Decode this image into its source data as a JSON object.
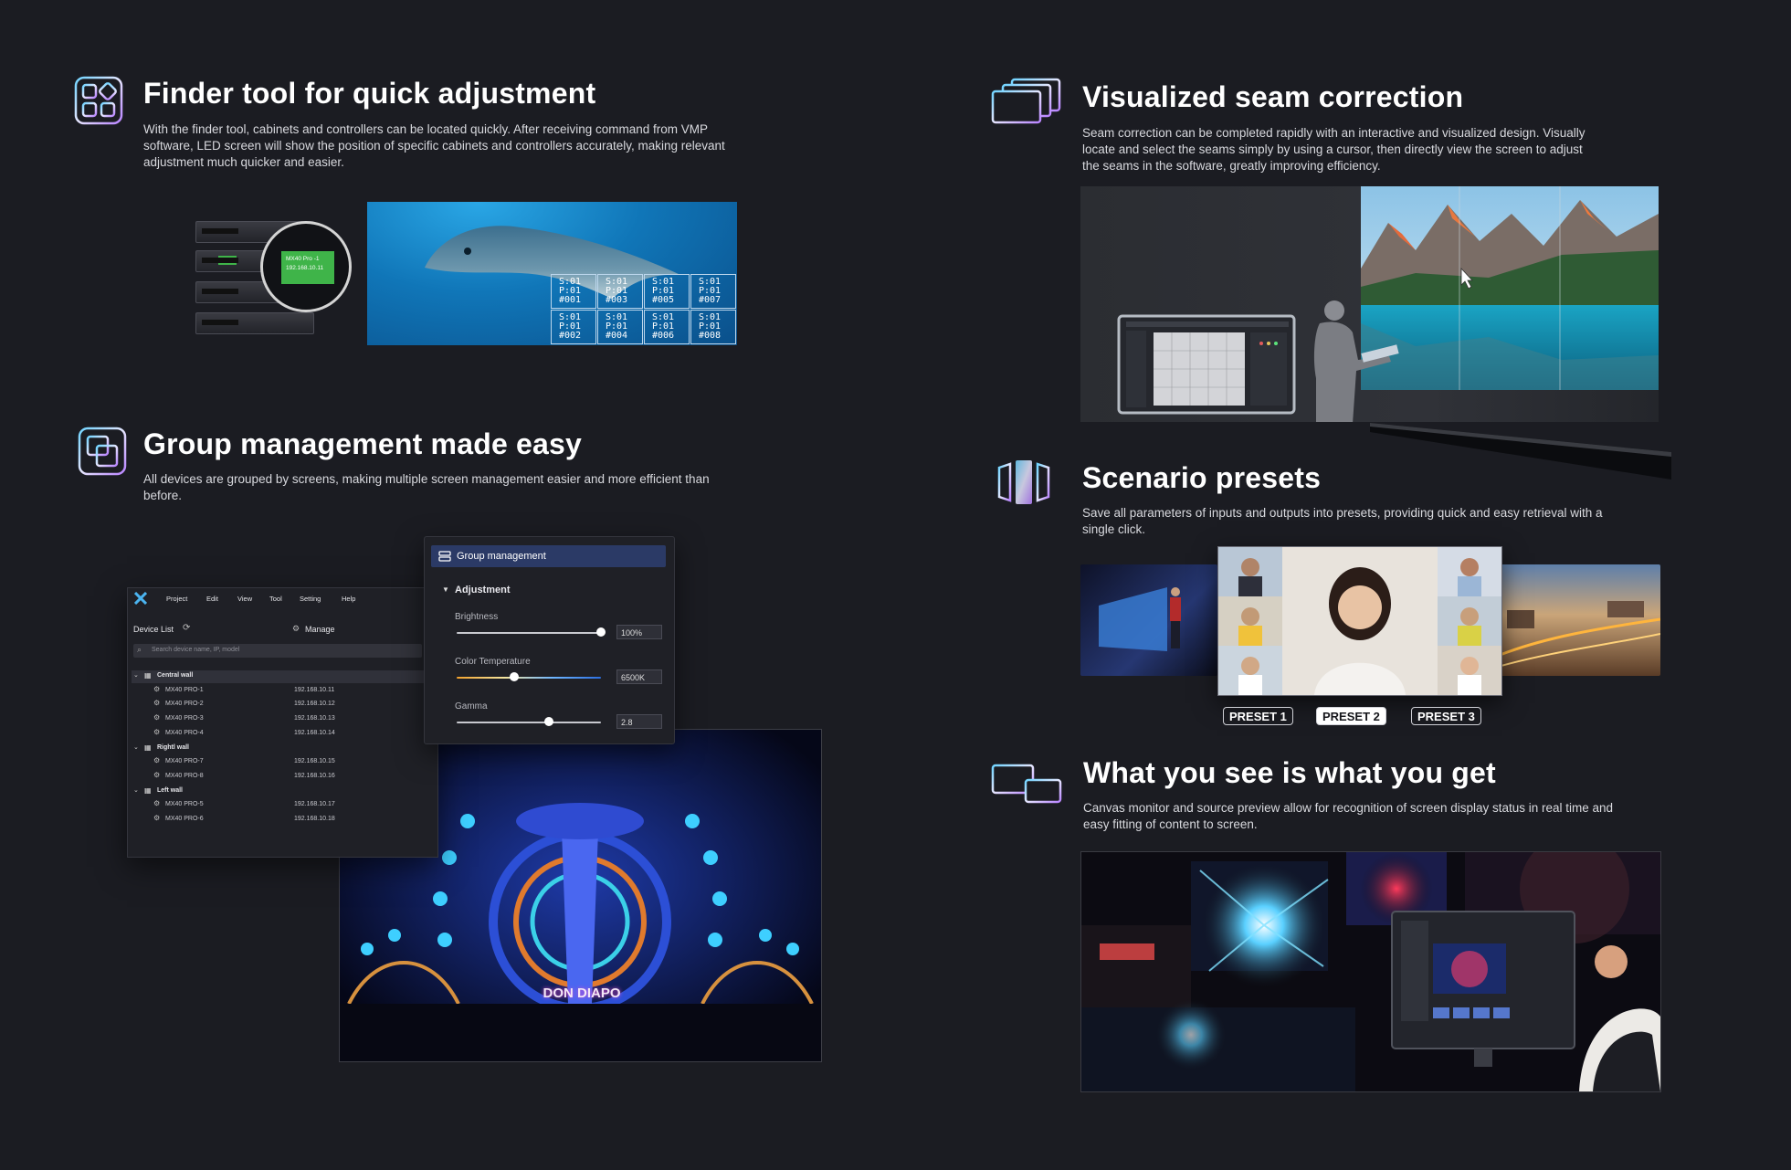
{
  "features": {
    "finder": {
      "title": "Finder tool for quick adjustment",
      "description": "With the finder tool, cabinets and controllers can be located quickly. After receiving command from VMP software, LED screen will show the position of specific cabinets and controllers accurately, making relevant adjustment much quicker and easier.",
      "badge_model": "MX40 Pro -1",
      "badge_ip": "192.168.10.11",
      "cells": [
        {
          "s": "S:01",
          "p": "P:01",
          "id": "#001"
        },
        {
          "s": "S:01",
          "p": "P:01",
          "id": "#003"
        },
        {
          "s": "S:01",
          "p": "P:01",
          "id": "#005"
        },
        {
          "s": "S:01",
          "p": "P:01",
          "id": "#007"
        },
        {
          "s": "S:01",
          "p": "P:01",
          "id": "#002"
        },
        {
          "s": "S:01",
          "p": "P:01",
          "id": "#004"
        },
        {
          "s": "S:01",
          "p": "P:01",
          "id": "#006"
        },
        {
          "s": "S:01",
          "p": "P:01",
          "id": "#008"
        }
      ]
    },
    "seam": {
      "title": "Visualized seam correction",
      "description": "Seam correction can be completed rapidly with an interactive and visualized design. Visually locate and select the seams simply by using a cursor, then directly view the screen to adjust the seams in the software, greatly improving efficiency."
    },
    "group": {
      "title": "Group management made easy",
      "description": "All devices are grouped by screens, making multiple screen management easier and more efficient than before.",
      "menu": [
        "Project",
        "Edit",
        "View",
        "Tool",
        "Setting",
        "Help"
      ],
      "device_list_label": "Device List",
      "manage_label": "Manage",
      "search_placeholder": "Search device name, IP, model",
      "groups": [
        {
          "name": "Central wall",
          "devices": [
            {
              "name": "MX40 PRO-1",
              "ip": "192.168.10.11"
            },
            {
              "name": "MX40 PRO-2",
              "ip": "192.168.10.12"
            },
            {
              "name": "MX40 PRO-3",
              "ip": "192.168.10.13"
            },
            {
              "name": "MX40 PRO-4",
              "ip": "192.168.10.14"
            }
          ]
        },
        {
          "name": "Rightl wall",
          "devices": [
            {
              "name": "MX40 PRO-7",
              "ip": "192.168.10.15"
            },
            {
              "name": "MX40 PRO-8",
              "ip": "192.168.10.16"
            }
          ]
        },
        {
          "name": "Left wall",
          "devices": [
            {
              "name": "MX40 PRO-5",
              "ip": "192.168.10.17"
            },
            {
              "name": "MX40 PRO-6",
              "ip": "192.168.10.18"
            }
          ]
        }
      ],
      "panel_title": "Group management",
      "adjustment_label": "Adjustment",
      "brightness": {
        "label": "Brightness",
        "value": "100%",
        "fraction": 1.0
      },
      "color_temp": {
        "label": "Color Temperature",
        "value": "6500K",
        "fraction": 0.4
      },
      "gamma": {
        "label": "Gamma",
        "value": "2.8",
        "fraction": 0.64
      },
      "sign_text": "DON DIAPO"
    },
    "presets": {
      "title": "Scenario presets",
      "description": "Save all parameters of inputs and outputs into presets, providing quick and easy retrieval with a single click.",
      "buttons": [
        "PRESET 1",
        "PRESET 2",
        "PRESET 3"
      ],
      "active_index": 1
    },
    "wysiwyg": {
      "title": "What you see is what you get",
      "description": "Canvas monitor and source preview allow for recognition of screen display status in real time and easy fitting of content to screen."
    }
  },
  "colors": {
    "background": "#1b1c22",
    "icon_gradient_start": "#6fd3ff",
    "icon_gradient_end": "#b883ff",
    "finder_badge": "#3fb449",
    "panel_header": "#2b3a66"
  },
  "icons": {
    "finder": "finder-grid-icon",
    "seam": "stacked-screens-icon",
    "group": "group-squares-icon",
    "presets": "preset-panels-icon",
    "wysiwyg": "monitor-pair-icon"
  }
}
